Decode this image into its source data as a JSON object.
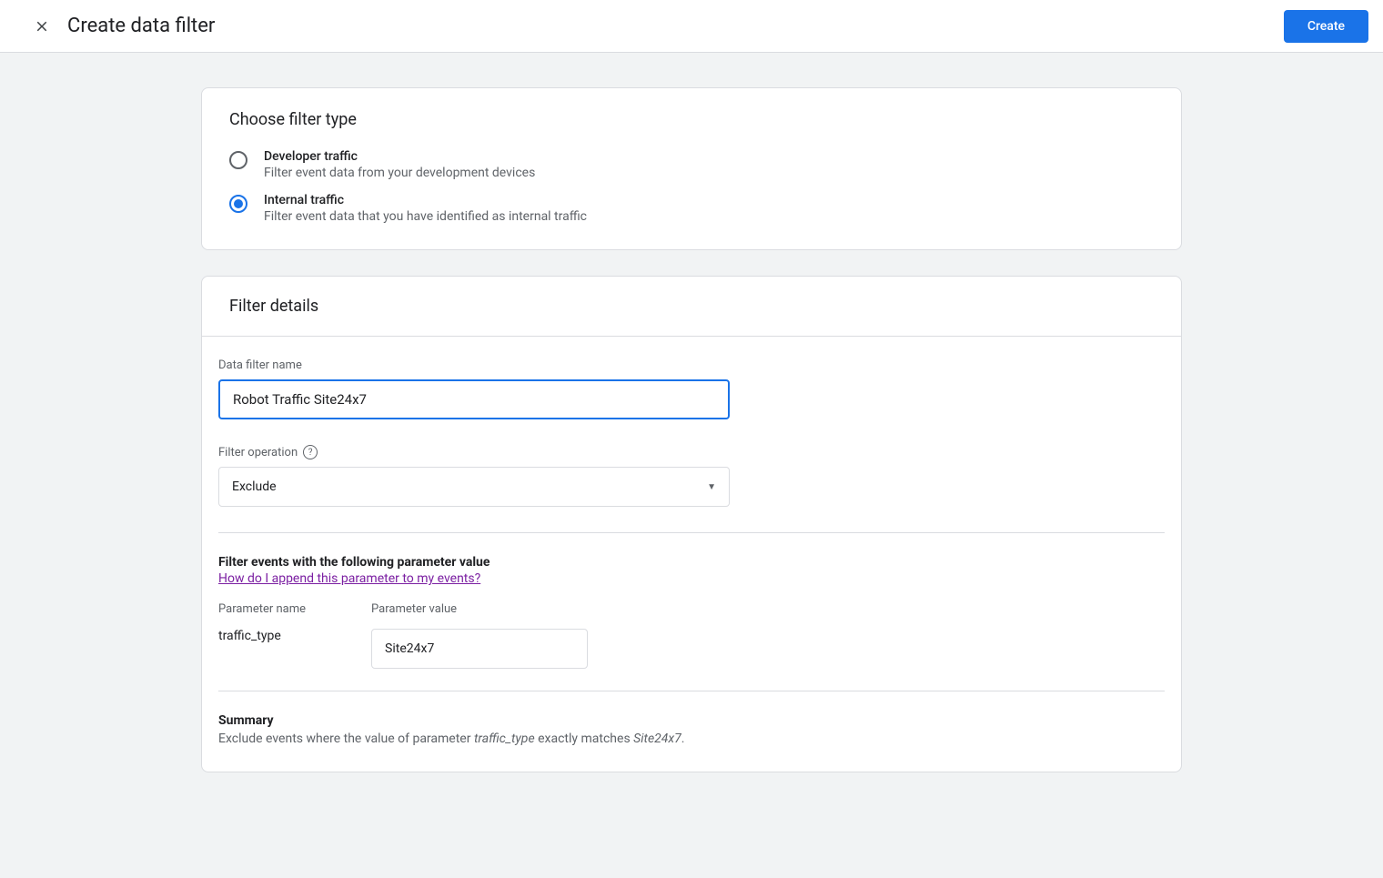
{
  "header": {
    "title": "Create data filter",
    "create_button": "Create"
  },
  "filter_type": {
    "section_title": "Choose filter type",
    "options": [
      {
        "title": "Developer traffic",
        "desc": "Filter event data from your development devices",
        "selected": false
      },
      {
        "title": "Internal traffic",
        "desc": "Filter event data that you have identified as internal traffic",
        "selected": true
      }
    ]
  },
  "filter_details": {
    "section_title": "Filter details",
    "name_label": "Data filter name",
    "name_value": "Robot Traffic Site24x7",
    "operation_label": "Filter operation",
    "operation_value": "Exclude",
    "events_heading": "Filter events with the following parameter value",
    "help_link": "How do I append this parameter to my events?",
    "param_name_label": "Parameter name",
    "param_name_value": "traffic_type",
    "param_value_label": "Parameter value",
    "param_value_input": "Site24x7",
    "summary_label": "Summary",
    "summary_prefix": "Exclude events where the value of parameter ",
    "summary_param": "traffic_type",
    "summary_mid": " exactly matches ",
    "summary_val": "Site24x7",
    "summary_suffix": "."
  }
}
